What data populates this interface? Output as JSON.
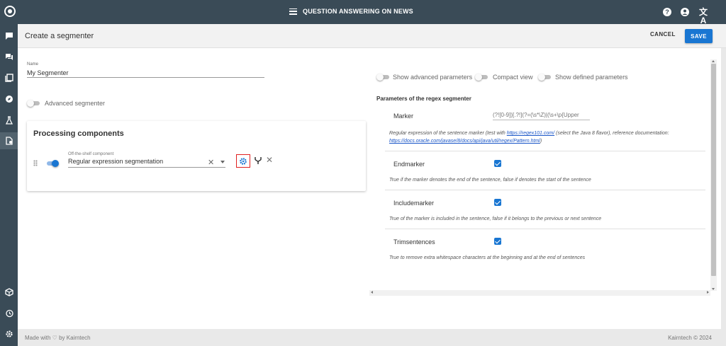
{
  "topbar": {
    "app_title": "QUESTION ANSWERING ON NEWS",
    "help_icon": "?",
    "account_icon": "●",
    "translate_icon": "文A"
  },
  "sidebar": {
    "items": [
      "chat-help-icon",
      "conversations-icon",
      "documents-icon",
      "compass-icon",
      "flask-icon",
      "segmenter-icon"
    ],
    "bottom_items": [
      "cube-icon",
      "history-icon",
      "settings-icon"
    ],
    "active": "segmenter-icon"
  },
  "header": {
    "page_title": "Create a segmenter",
    "cancel_label": "CANCEL",
    "save_label": "SAVE"
  },
  "form": {
    "name_label": "Name",
    "name_value": "My Segmenter",
    "advanced_segmenter_label": "Advanced segmenter"
  },
  "processing": {
    "title": "Processing components",
    "component_label": "Off-the-shelf component",
    "component_value": "Regular expression segmentation"
  },
  "view_toggles": {
    "show_advanced": "Show advanced parameters",
    "compact_view": "Compact view",
    "show_defined": "Show defined parameters"
  },
  "params": {
    "title": "Parameters of the regex segmenter",
    "marker": {
      "name": "Marker",
      "placeholder": "(?![0-9])[.?!](?=(\\s*\\Z)|(\\s+\\p{Upper",
      "desc_prefix": "Regular expression of the sentence marker (test with ",
      "link1": "https://regex101.com/",
      "desc_middle": " (select the Java 8 flavor), reference documentation:",
      "link2": "https://docs.oracle.com/javase/8/docs/api/java/util/regex/Pattern.html",
      "desc_suffix": ")"
    },
    "endmarker": {
      "name": "Endmarker",
      "desc": "True if the marker denotes the end of the sentence, false if denotes the start of the sentence"
    },
    "includemarker": {
      "name": "Includemarker",
      "desc": "True of the marker is included in the sentence, false if it belongs to the previous or next sentence"
    },
    "trimsentences": {
      "name": "Trimsentences",
      "desc": "True to remove extra whitespace characters at the beginning and at the end of sentences"
    }
  },
  "footer": {
    "left": "Made with ♡ by Kairntech",
    "right": "Kairntech © 2024"
  }
}
